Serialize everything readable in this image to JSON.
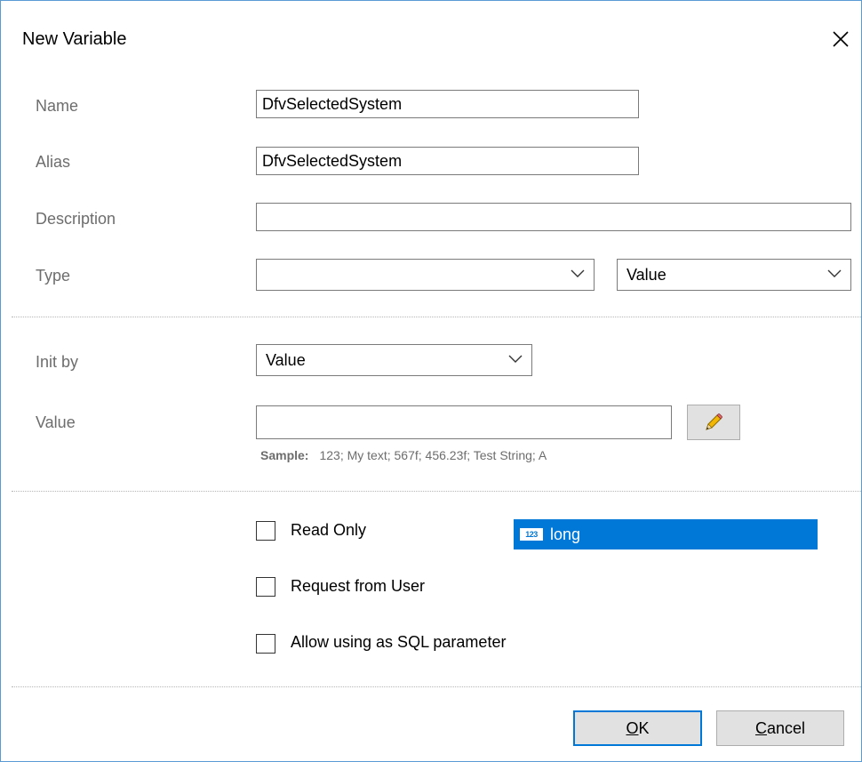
{
  "dialog": {
    "title": "New Variable",
    "close_icon": "close-icon"
  },
  "form": {
    "name": {
      "label": "Name",
      "value": "DfvSelectedSystem"
    },
    "alias": {
      "label": "Alias",
      "value": "DfvSelectedSystem"
    },
    "description": {
      "label": "Description",
      "value": ""
    },
    "type": {
      "label": "Type",
      "selected": "long",
      "type_icon": "numeric-type-icon",
      "type_icon_text": "123",
      "kind": "Value"
    },
    "init_by": {
      "label": "Init by",
      "selected": "Value"
    },
    "value": {
      "label": "Value",
      "value": "",
      "edit_icon": "pencil-icon",
      "sample_label": "Sample:",
      "sample_text": "123; My text; 567f; 456.23f; Test String; A"
    }
  },
  "options": {
    "read_only": {
      "label": "Read Only",
      "checked": false
    },
    "request_from_user": {
      "label": "Request from User",
      "checked": false
    },
    "sql_parameter": {
      "label": "Allow using as SQL parameter",
      "checked": false
    }
  },
  "buttons": {
    "ok": {
      "mnemonic": "O",
      "rest": "K"
    },
    "cancel": {
      "mnemonic": "C",
      "rest": "ancel"
    }
  },
  "colors": {
    "accent": "#0078d7",
    "border": "#5b9bd5",
    "label": "#6d6d6d"
  }
}
